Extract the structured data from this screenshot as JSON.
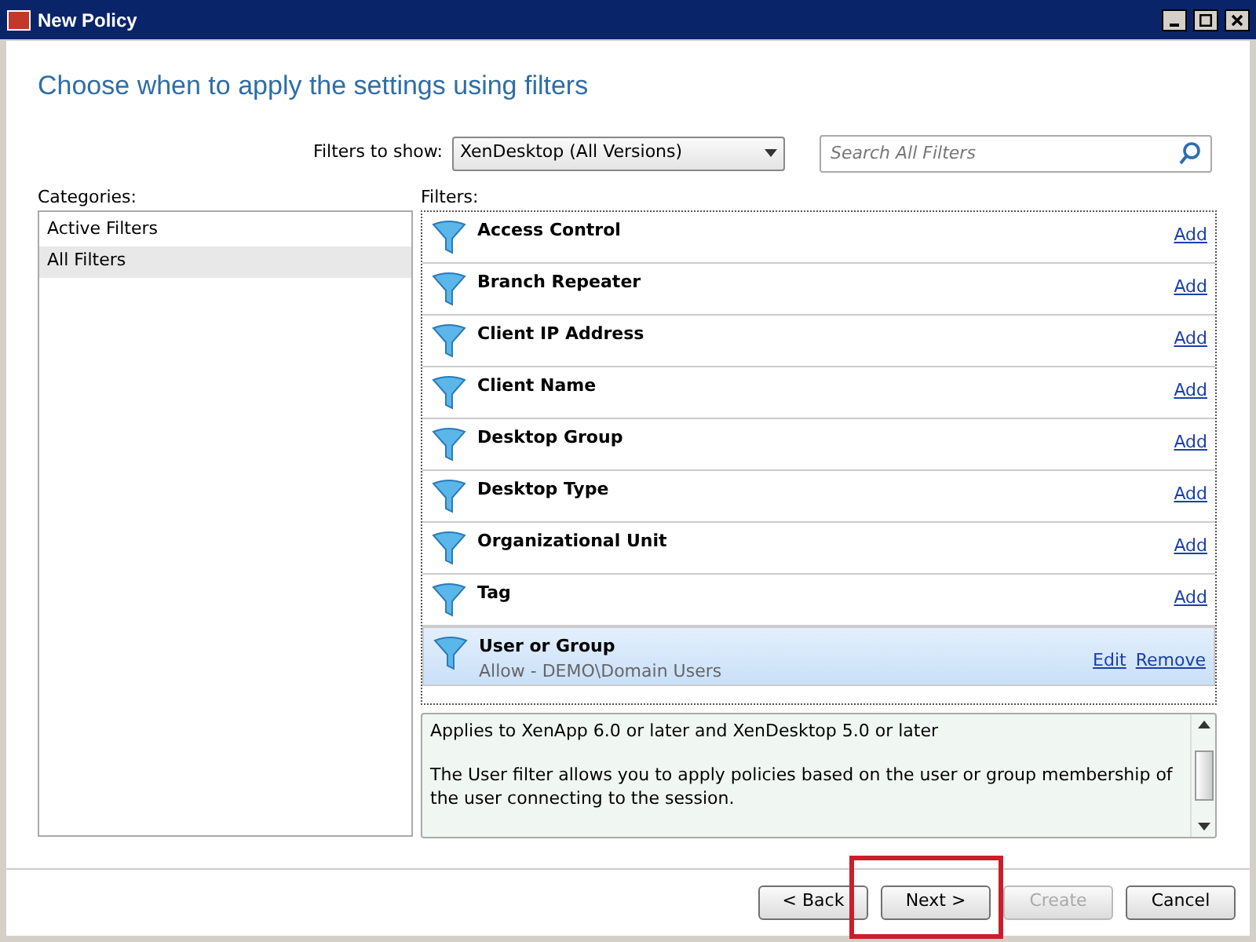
{
  "window": {
    "title": "New Policy"
  },
  "heading": "Choose when to apply the settings using filters",
  "filters_to_show": {
    "label": "Filters to show:",
    "value": "XenDesktop (All Versions)"
  },
  "search": {
    "placeholder": "Search All Filters"
  },
  "categories": {
    "label": "Categories:",
    "items": [
      {
        "label": "Active Filters",
        "selected": false
      },
      {
        "label": "All Filters",
        "selected": true
      }
    ]
  },
  "filters": {
    "label": "Filters:",
    "items": [
      {
        "name": "Access Control",
        "selected": false,
        "actions": [
          "Add"
        ]
      },
      {
        "name": "Branch Repeater",
        "selected": false,
        "actions": [
          "Add"
        ]
      },
      {
        "name": "Client IP Address",
        "selected": false,
        "actions": [
          "Add"
        ]
      },
      {
        "name": "Client Name",
        "selected": false,
        "actions": [
          "Add"
        ]
      },
      {
        "name": "Desktop Group",
        "selected": false,
        "actions": [
          "Add"
        ]
      },
      {
        "name": "Desktop Type",
        "selected": false,
        "actions": [
          "Add"
        ]
      },
      {
        "name": "Organizational Unit",
        "selected": false,
        "actions": [
          "Add"
        ]
      },
      {
        "name": "Tag",
        "selected": false,
        "actions": [
          "Add"
        ]
      },
      {
        "name": "User or Group",
        "selected": true,
        "detail": "Allow - DEMO\\Domain Users",
        "actions": [
          "Edit",
          "Remove"
        ]
      }
    ]
  },
  "description": {
    "lines": [
      "Applies to XenApp 6.0 or later and XenDesktop 5.0 or later",
      "The User filter allows you to apply policies based on the user or group membership of the user connecting to the session."
    ]
  },
  "buttons": [
    {
      "label": "< Back",
      "disabled": false,
      "highlighted": false
    },
    {
      "label": "Next >",
      "disabled": false,
      "highlighted": true
    },
    {
      "label": "Create",
      "disabled": true,
      "highlighted": false
    },
    {
      "label": "Cancel",
      "disabled": false,
      "highlighted": false
    }
  ]
}
